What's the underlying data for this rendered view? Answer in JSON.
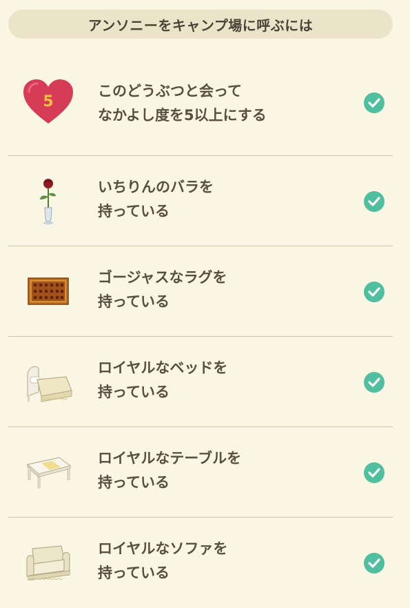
{
  "header": {
    "title": "アンソニーをキャンプ場に呼ぶには"
  },
  "requirements": [
    {
      "icon": "heart-icon",
      "badge": "5",
      "line1": "このどうぶつと会って",
      "line2": "なかよし度を5以上にする",
      "completed": true
    },
    {
      "icon": "rose-vase-icon",
      "line1": "いちりんのバラを",
      "line2": "持っている",
      "completed": true
    },
    {
      "icon": "rug-icon",
      "line1": "ゴージャスなラグを",
      "line2": "持っている",
      "completed": true
    },
    {
      "icon": "bed-icon",
      "line1": "ロイヤルなベッドを",
      "line2": "持っている",
      "completed": true
    },
    {
      "icon": "table-icon",
      "line1": "ロイヤルなテーブルを",
      "line2": "持っている",
      "completed": true
    },
    {
      "icon": "sofa-icon",
      "line1": "ロイヤルなソファを",
      "line2": "持っている",
      "completed": true
    }
  ],
  "colors": {
    "background": "#f9f6e3",
    "header": "#ece4c9",
    "check": "#4fbf9f",
    "heart": "#d63c55",
    "divider": "#cdc6ad"
  }
}
